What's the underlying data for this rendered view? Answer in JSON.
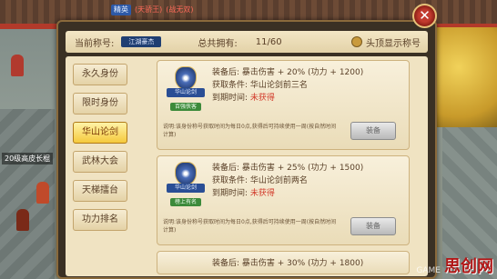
{
  "top_bar": {
    "tag": "精英",
    "name1": "(天骄王)",
    "name2": "(战无双)"
  },
  "npc_label": "20级高皮长棍",
  "header": {
    "current_label": "当前称号:",
    "current_title": "江湖豪杰",
    "total_label": "总共拥有:",
    "count": "11/60",
    "show_label": "头顶显示称号"
  },
  "sidebar": {
    "tabs": [
      {
        "label": "永久身份",
        "active": false
      },
      {
        "label": "限时身份",
        "active": false
      },
      {
        "label": "华山论剑",
        "active": true
      },
      {
        "label": "武林大会",
        "active": false
      },
      {
        "label": "天梯擂台",
        "active": false
      },
      {
        "label": "功力排名",
        "active": false
      }
    ]
  },
  "cards": [
    {
      "badge_text": "华山论剑",
      "badge_sub": "百强侠客",
      "equip_label": "装备后:",
      "equip_value": "暴击伤害 + 20% (功力 + 1200)",
      "cond_label": "获取条件:",
      "cond_value": "华山论剑前三名",
      "expire_label": "到期时间:",
      "expire_value": "未获得",
      "note": "说明:该身份称号获取时间为每日0点,获得后可持续使用一周(按自然时间计算)",
      "button": "装备"
    },
    {
      "badge_text": "华山论剑",
      "badge_sub": "榜上有名",
      "equip_label": "装备后:",
      "equip_value": "暴击伤害 + 25% (功力 + 1500)",
      "cond_label": "获取条件:",
      "cond_value": "华山论剑前两名",
      "expire_label": "到期时间:",
      "expire_value": "未获得",
      "note": "说明:该身份称号获取时间为每日0点,获得后可持续使用一周(按自然时间计算)",
      "button": "装备"
    },
    {
      "equip_label": "装备后:",
      "equip_value": "暴击伤害 + 30% (功力 + 1800)"
    }
  ],
  "watermark": "思创网",
  "watermark_sub": "GAME"
}
